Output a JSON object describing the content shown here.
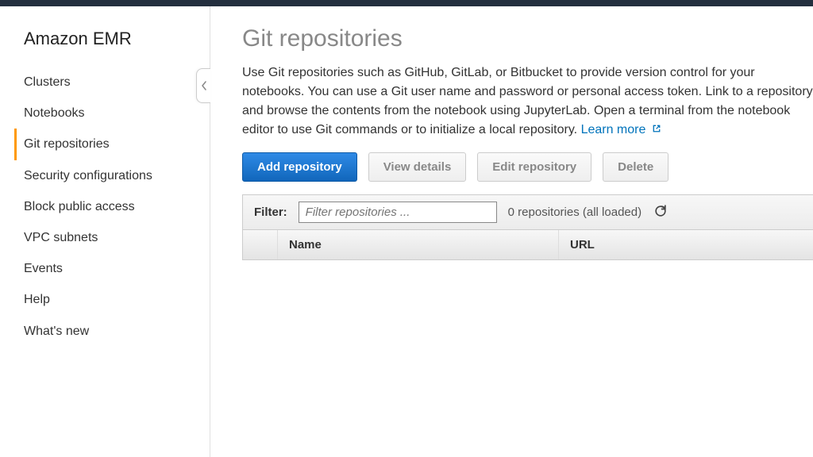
{
  "sidebar": {
    "title": "Amazon EMR",
    "items": [
      {
        "label": "Clusters",
        "active": false
      },
      {
        "label": "Notebooks",
        "active": false
      },
      {
        "label": "Git repositories",
        "active": true
      },
      {
        "label": "Security configurations",
        "active": false
      },
      {
        "label": "Block public access",
        "active": false
      },
      {
        "label": "VPC subnets",
        "active": false
      },
      {
        "label": "Events",
        "active": false
      },
      {
        "label": "Help",
        "active": false
      },
      {
        "label": "What's new",
        "active": false
      }
    ]
  },
  "page": {
    "title": "Git repositories",
    "description": "Use Git repositories such as GitHub, GitLab, or Bitbucket to provide version control for your notebooks. You can use a Git user name and password or personal access token. Link to a repository and browse the contents from the notebook using JupyterLab. Open a terminal from the notebook editor to use Git commands or to initialize a local repository.",
    "learn_more": "Learn more"
  },
  "toolbar": {
    "add": "Add repository",
    "view": "View details",
    "edit": "Edit repository",
    "delete": "Delete"
  },
  "filter": {
    "label": "Filter:",
    "placeholder": "Filter repositories ...",
    "status": "0 repositories (all loaded)"
  },
  "table": {
    "columns": {
      "name": "Name",
      "url": "URL"
    }
  }
}
